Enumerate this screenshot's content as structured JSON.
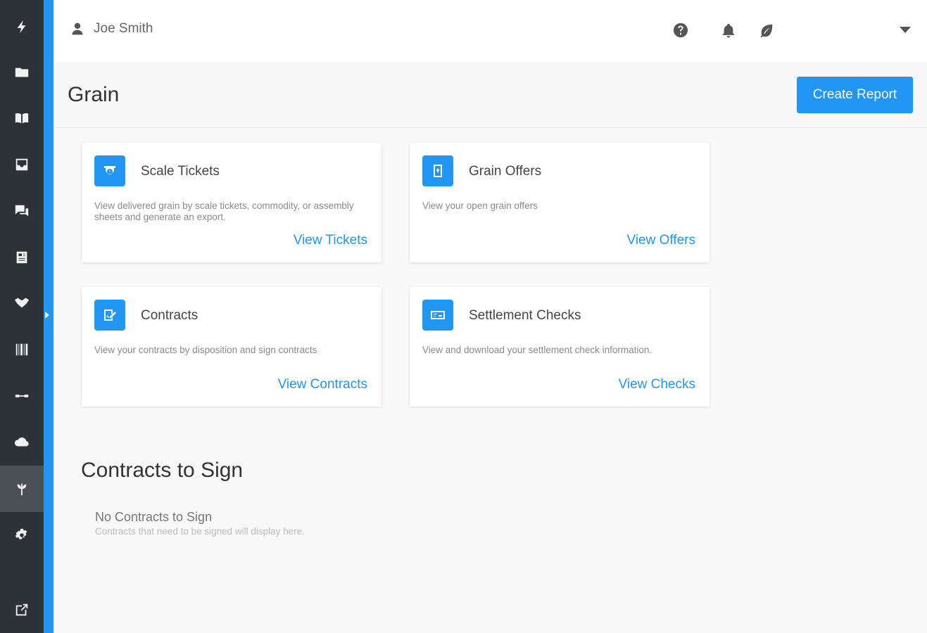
{
  "user": {
    "name": "Joe Smith"
  },
  "page": {
    "title": "Grain",
    "create_label": "Create Report"
  },
  "cards": [
    {
      "icon": "scale-icon",
      "title": "Scale Tickets",
      "description": "View delivered grain by scale tickets, commodity, or assembly sheets and generate an export.",
      "link": "View Tickets"
    },
    {
      "icon": "grain-bag-icon",
      "title": "Grain Offers",
      "description": "View your open grain offers",
      "link": "View Offers"
    },
    {
      "icon": "signature-icon",
      "title": "Contracts",
      "description": "View your contracts by disposition and sign contracts",
      "link": "View Contracts"
    },
    {
      "icon": "check-icon",
      "title": "Settlement Checks",
      "description": "View and download your settlement check information.",
      "link": "View Checks"
    }
  ],
  "contracts_to_sign": {
    "title": "Contracts to Sign",
    "empty_title": "No Contracts to Sign",
    "empty_sub": "Contracts that need to be signed will display here."
  },
  "sidebar_icons": [
    "lightning-icon",
    "folder-icon",
    "book-icon",
    "inbox-icon",
    "chat-icon",
    "newspaper-icon",
    "handshake-icon",
    "barcode-icon",
    "link-icon",
    "cloud-icon",
    "plant-icon",
    "gear-icon",
    "external-link-icon"
  ],
  "top_icons": [
    "help-icon",
    "bell-icon",
    "leaf-icon",
    "chevron-down-icon"
  ],
  "colors": {
    "accent": "#2196f3",
    "sidebar": "#2c3238"
  }
}
